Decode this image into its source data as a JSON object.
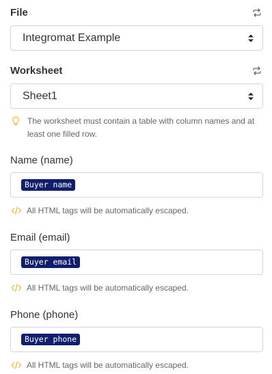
{
  "file": {
    "label": "File",
    "selected": "Integromat Example"
  },
  "worksheet": {
    "label": "Worksheet",
    "selected": "Sheet1",
    "hint": "The worksheet must contain a table with column names and at least one filled row."
  },
  "fields": [
    {
      "label": "Name (name)",
      "value": "Buyer name",
      "hint": "All HTML tags will be automatically escaped."
    },
    {
      "label": "Email (email)",
      "value": "Buyer email",
      "hint": "All HTML tags will be automatically escaped."
    },
    {
      "label": "Phone (phone)",
      "value": "Buyer phone",
      "hint": "All HTML tags will be automatically escaped."
    }
  ],
  "colors": {
    "pill_background": "#0f1e6e",
    "hint_icon": "#f2b92f",
    "border": "#d5d5d5"
  },
  "icons": [
    "refresh-icon",
    "select-caret-icon",
    "lightbulb-icon",
    "code-icon"
  ]
}
